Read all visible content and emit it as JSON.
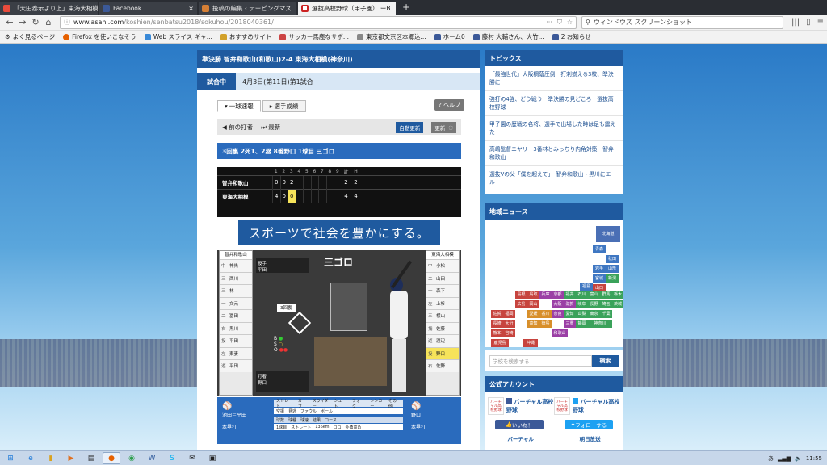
{
  "browser": {
    "tabs": [
      {
        "label": "「大田泰示より上」東海大相模",
        "icon_color": "#e94b3c"
      },
      {
        "label": "Facebook",
        "icon_color": "#3b5998"
      },
      {
        "label": "投稿の編集 ‹ テーピングマス...",
        "icon_color": "#888888"
      },
      {
        "label": "選抜高校野球（甲子園） ーB...",
        "icon_color": "#cc2222",
        "active": true
      }
    ],
    "new_tab": "+",
    "url_host": "www.asahi.com",
    "url_path": "/koshien/senbatsu2018/sokuhou/2018040361/",
    "url_prefix": "https://",
    "search_text": "ウィンドウズ スクリーンショット",
    "bookmarks": [
      "よく見るページ",
      "Firefox を使いこなそう",
      "Web スライス ギャ...",
      "おすすめサイト",
      "サッカー馬鹿なサポ...",
      "東京都文京区本郷込...",
      "ホーム0",
      "藤村 大輔さん、大竹...",
      "2 お知らせ"
    ]
  },
  "game": {
    "header": "準決勝 智弁和歌山(和歌山)2-4 東海大相模(神奈川)",
    "status_label": "試合中",
    "date_text": "4月3日(第11日)第1試合",
    "tab_pitch": "一球速報",
    "tab_stats": "選手成績",
    "help": "? ヘルプ",
    "prev": "前の打者",
    "latest": "最新",
    "auto_update": "自動更新",
    "update": "更新",
    "play_text": "3回裏 2死1、2塁 8番野口 1球目 三ゴロ",
    "innings": [
      "1",
      "2",
      "3",
      "4",
      "5",
      "6",
      "7",
      "8",
      "9",
      "計",
      "H"
    ],
    "teams": [
      {
        "name": "智弁和歌山",
        "scores": [
          "0",
          "0",
          "2",
          "",
          "",
          "",
          "",
          "",
          ""
        ],
        "total": "2",
        "hits": "2"
      },
      {
        "name": "東海大相模",
        "scores": [
          "4",
          "0",
          "0",
          "",
          "",
          "",
          "",
          "",
          ""
        ],
        "total": "4",
        "hits": "4"
      }
    ],
    "highlight_cell": "1-2",
    "ad_text": "スポーツで社会を豊かにする。",
    "result_label": "三ゴロ",
    "away_label": "智弁和歌山",
    "home_label": "東海大相模",
    "away_lineup": [
      [
        "中",
        "神先"
      ],
      [
        "三",
        "西川"
      ],
      [
        "三",
        "林"
      ],
      [
        "一",
        "文元"
      ],
      [
        "二",
        "冨田"
      ],
      [
        "右",
        "黒川"
      ],
      [
        "投",
        "平田"
      ],
      [
        "左",
        "東妻"
      ],
      [
        "遊",
        "平田"
      ]
    ],
    "home_lineup": [
      [
        "中",
        "小松"
      ],
      [
        "二",
        "山田"
      ],
      [
        "一",
        "森下"
      ],
      [
        "左",
        "上杉"
      ],
      [
        "三",
        "横山"
      ],
      [
        "捕",
        "佐藤"
      ],
      [
        "遊",
        "渡辺"
      ],
      [
        "投",
        "野口"
      ],
      [
        "右",
        "佐野"
      ]
    ],
    "pitcher_label": "投手",
    "pitcher_name": "平田",
    "batter_label": "打者",
    "batter_name": "野口",
    "legend_items": [
      "ストレート",
      "カーブ",
      "スライダー",
      "シュート",
      "フォーク",
      "シンカー",
      "その他"
    ],
    "result_items": [
      "空振",
      "見逃",
      "ファウル",
      "ボール"
    ],
    "pitch_headers": [
      "球数",
      "球種",
      "球速",
      "結果",
      "コース"
    ],
    "pitch_row": [
      "1球目",
      "ストレート",
      "136km",
      "ゴロ",
      "外角高め"
    ],
    "pitcher_bottom": "池田＝平田",
    "batter_bottom": "野口",
    "bench_left": "本塁打",
    "bench_right": "本塁打",
    "outs_label": "3回裏",
    "count_b": "B",
    "count_s": "S",
    "count_o": "O"
  },
  "sidebar": {
    "topics_title": "トピックス",
    "topics": [
      "「最強世代」大阪桐蔭圧倒　打刺揃える3校、準決勝に",
      "強打の4強、どう戦う　準決勝の見どころ　選抜高校野球",
      "甲子園の歴戦の名将、選手で出場した時は足も震えた",
      "高嶋監督ニヤリ　3番林とみっちり内角対策　智弁和歌山",
      "選抜Vの父「僕を超えて」　智弁和歌山・黒川にエール"
    ],
    "news_title": "地域ニュース",
    "prefectures": [
      {
        "n": "北海道",
        "c": "#4a6fb5"
      },
      {
        "n": "青森",
        "c": "#3f77c2"
      },
      {
        "n": "秋田",
        "c": "#3f77c2"
      },
      {
        "n": "岩手",
        "c": "#3f77c2"
      },
      {
        "n": "山形",
        "c": "#3f77c2"
      },
      {
        "n": "宮城",
        "c": "#3f77c2"
      },
      {
        "n": "新潟",
        "c": "#3aa25a"
      },
      {
        "n": "福島",
        "c": "#3f77c2"
      },
      {
        "n": "山口",
        "c": "#c7443e"
      },
      {
        "n": "島根",
        "c": "#c7443e"
      },
      {
        "n": "鳥取",
        "c": "#c7443e"
      },
      {
        "n": "兵庫",
        "c": "#9b3fa5"
      },
      {
        "n": "京都",
        "c": "#9b3fa5"
      },
      {
        "n": "福井",
        "c": "#3aa25a"
      },
      {
        "n": "石川",
        "c": "#3aa25a"
      },
      {
        "n": "富山",
        "c": "#3aa25a"
      },
      {
        "n": "群馬",
        "c": "#3aa25a"
      },
      {
        "n": "栃木",
        "c": "#3aa25a"
      },
      {
        "n": "広島",
        "c": "#c7443e"
      },
      {
        "n": "岡山",
        "c": "#c7443e"
      },
      {
        "n": "大阪",
        "c": "#9b3fa5"
      },
      {
        "n": "滋賀",
        "c": "#9b3fa5"
      },
      {
        "n": "岐阜",
        "c": "#3aa25a"
      },
      {
        "n": "長野",
        "c": "#3aa25a"
      },
      {
        "n": "埼玉",
        "c": "#3aa25a"
      },
      {
        "n": "茨城",
        "c": "#3aa25a"
      },
      {
        "n": "佐賀",
        "c": "#c7443e"
      },
      {
        "n": "福岡",
        "c": "#c7443e"
      },
      {
        "n": "愛媛",
        "c": "#d88f2a"
      },
      {
        "n": "香川",
        "c": "#d88f2a"
      },
      {
        "n": "奈良",
        "c": "#9b3fa5"
      },
      {
        "n": "愛知",
        "c": "#3aa25a"
      },
      {
        "n": "山梨",
        "c": "#3aa25a"
      },
      {
        "n": "東京",
        "c": "#3aa25a"
      },
      {
        "n": "千葉",
        "c": "#3aa25a"
      },
      {
        "n": "長崎",
        "c": "#c7443e"
      },
      {
        "n": "大分",
        "c": "#c7443e"
      },
      {
        "n": "高知",
        "c": "#d88f2a"
      },
      {
        "n": "徳島",
        "c": "#d88f2a"
      },
      {
        "n": "三重",
        "c": "#9b3fa5"
      },
      {
        "n": "静岡",
        "c": "#3aa25a"
      },
      {
        "n": "神奈川",
        "c": "#3aa25a"
      },
      {
        "n": "熊本",
        "c": "#c7443e"
      },
      {
        "n": "宮崎",
        "c": "#c7443e"
      },
      {
        "n": "和歌山",
        "c": "#9b3fa5"
      },
      {
        "n": "鹿児島",
        "c": "#c7443e"
      },
      {
        "n": "沖縄",
        "c": "#c7443e"
      }
    ],
    "search_placeholder": "学校を検索する",
    "search_button": "検索",
    "accounts_title": "公式アカウント",
    "account_name": "バーチャル高校野球",
    "logo_text": "バーチャル高校野球",
    "like_label": "いいね！",
    "follow_label": "フォローする",
    "bottom_a": "バーチャル",
    "bottom_b": "朝日放送"
  },
  "taskbar": {
    "time": "11:55",
    "lang": "あ"
  },
  "colors": {
    "brand": "#1f5a9f",
    "accent": "#2a6bbd",
    "highlight": "#f6e35a"
  }
}
